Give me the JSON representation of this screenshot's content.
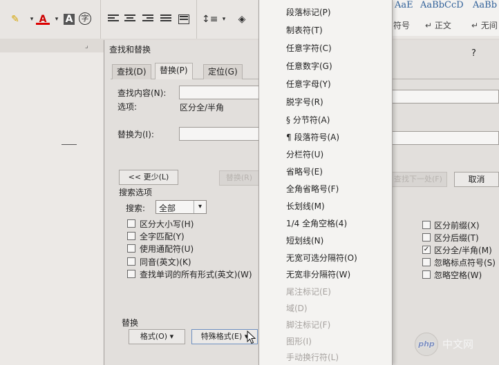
{
  "ribbon": {
    "style_samples": [
      {
        "sample": "AaE",
        "name": "符号"
      },
      {
        "sample": "AaBbCcD",
        "name": "↵ 正文"
      },
      {
        "sample": "AaBb",
        "name": "↵ 无间"
      }
    ],
    "icons": [
      "highlight-icon",
      "font-color-icon",
      "char-shading-icon",
      "enclose-char-icon",
      "align-left-icon",
      "align-center-icon",
      "align-right-icon",
      "justify-icon",
      "distributed-icon",
      "line-spacing-icon",
      "paint-bucket-icon"
    ]
  },
  "dialog": {
    "title": "查找和替换",
    "help": "?",
    "tabs": [
      {
        "label": "查找(D)"
      },
      {
        "label": "替换(P)"
      },
      {
        "label": "定位(G)"
      }
    ],
    "find_label": "查找内容(N):",
    "options_label": "选项:",
    "options_value": "区分全/半角",
    "replace_label": "替换为(I):",
    "less_button": "<< 更少(L)",
    "replace_button": "替换(R)",
    "find_next_button": "查找下一处(F)",
    "cancel_button": "取消",
    "search_options_title": "搜索选项",
    "search_label": "搜索:",
    "search_value": "全部",
    "left_options": [
      {
        "label": "区分大小写(H)",
        "checked": false
      },
      {
        "label": "全字匹配(Y)",
        "checked": false
      },
      {
        "label": "使用通配符(U)",
        "checked": false
      },
      {
        "label": "同音(英文)(K)",
        "checked": false
      },
      {
        "label": "查找单词的所有形式(英文)(W)",
        "checked": false
      }
    ],
    "right_options": [
      {
        "label": "区分前缀(X)",
        "checked": false
      },
      {
        "label": "区分后缀(T)",
        "checked": false
      },
      {
        "label": "区分全/半角(M)",
        "checked": true
      },
      {
        "label": "忽略标点符号(S)",
        "checked": false
      },
      {
        "label": "忽略空格(W)",
        "checked": false
      }
    ],
    "replace_section_title": "替换",
    "format_button": "格式(O) ▾",
    "special_button": "特殊格式(E) ▾"
  },
  "menu": {
    "items": [
      {
        "label": "段落标记(P)",
        "enabled": true
      },
      {
        "label": "制表符(T)",
        "enabled": true
      },
      {
        "label": "任意字符(C)",
        "enabled": true
      },
      {
        "label": "任意数字(G)",
        "enabled": true
      },
      {
        "label": "任意字母(Y)",
        "enabled": true
      },
      {
        "label": "脱字号(R)",
        "enabled": true
      },
      {
        "label": "§ 分节符(A)",
        "enabled": true
      },
      {
        "label": "¶ 段落符号(A)",
        "enabled": true
      },
      {
        "label": "分栏符(U)",
        "enabled": true
      },
      {
        "label": "省略号(E)",
        "enabled": true
      },
      {
        "label": "全角省略号(F)",
        "enabled": true
      },
      {
        "label": "长划线(M)",
        "enabled": true
      },
      {
        "label": "1/4 全角空格(4)",
        "enabled": true
      },
      {
        "label": "短划线(N)",
        "enabled": true
      },
      {
        "label": "无宽可选分隔符(O)",
        "enabled": true
      },
      {
        "label": "无宽非分隔符(W)",
        "enabled": true
      },
      {
        "label": "尾注标记(E)",
        "enabled": false
      },
      {
        "label": "域(D)",
        "enabled": false
      },
      {
        "label": "脚注标记(F)",
        "enabled": false
      },
      {
        "label": "图形(I)",
        "enabled": false
      },
      {
        "label": "手动换行符(L)",
        "enabled": false
      }
    ]
  },
  "watermark": {
    "logo": "php",
    "text": "中文网"
  }
}
